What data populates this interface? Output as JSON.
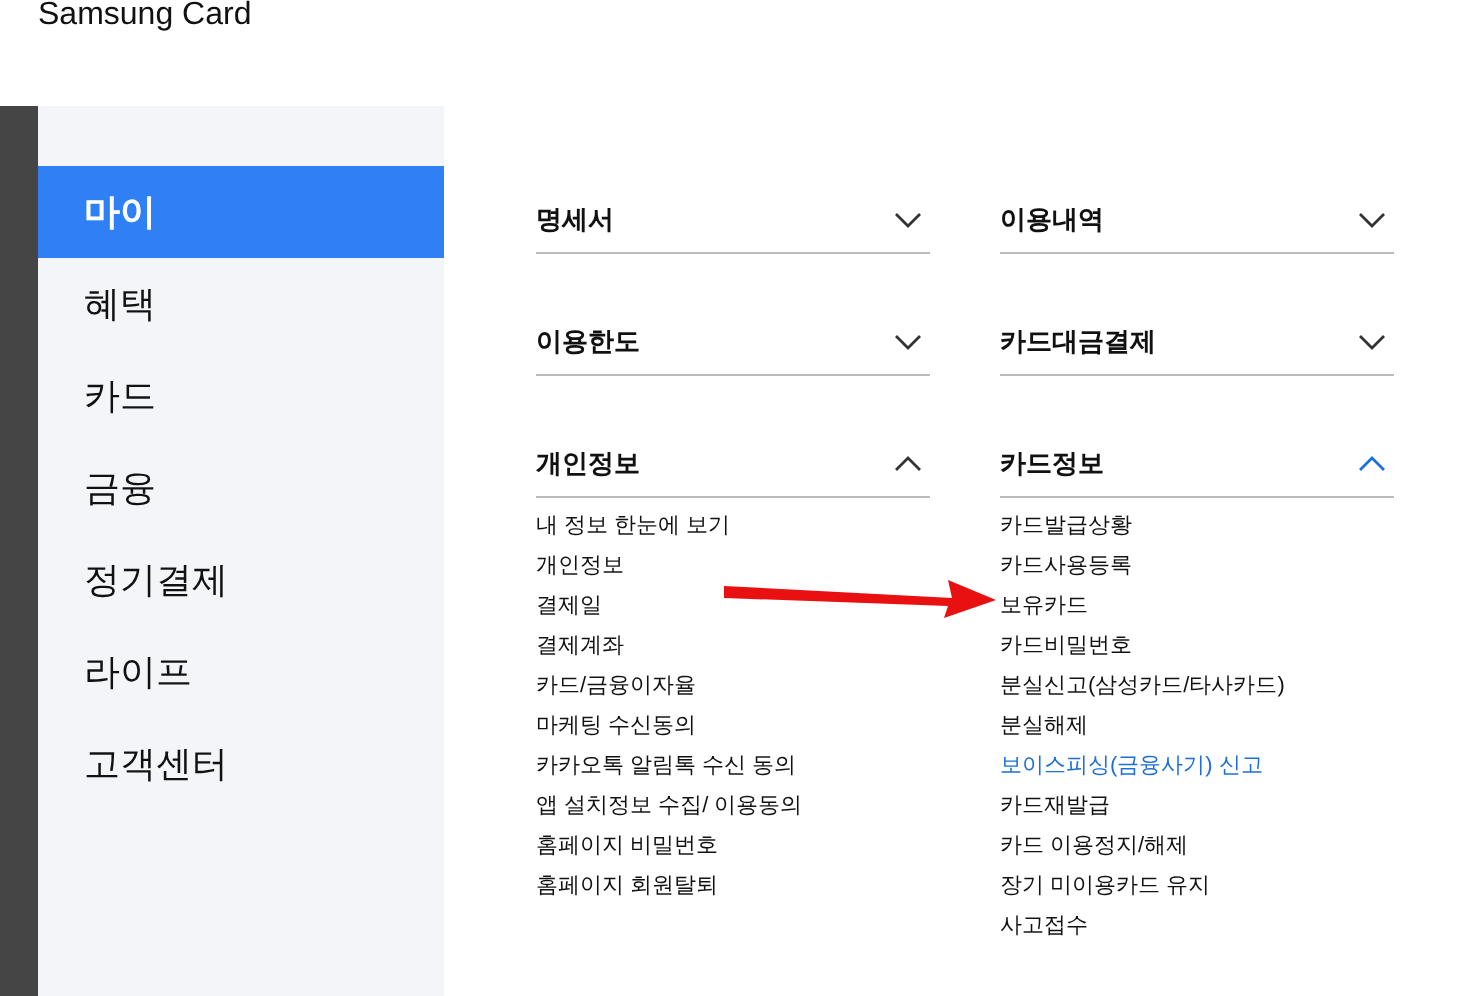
{
  "brand": "Samsung Card",
  "sidebar": {
    "items": [
      {
        "label": "마이",
        "selected": true
      },
      {
        "label": "혜택",
        "selected": false
      },
      {
        "label": "카드",
        "selected": false
      },
      {
        "label": "금융",
        "selected": false
      },
      {
        "label": "정기결제",
        "selected": false
      },
      {
        "label": "라이프",
        "selected": false
      },
      {
        "label": "고객센터",
        "selected": false
      }
    ]
  },
  "sections": [
    {
      "title": "명세서",
      "expanded": false,
      "active": false
    },
    {
      "title": "이용내역",
      "expanded": false,
      "active": false
    },
    {
      "title": "이용한도",
      "expanded": false,
      "active": false
    },
    {
      "title": "카드대금결제",
      "expanded": false,
      "active": false
    },
    {
      "title": "개인정보",
      "expanded": true,
      "active": false,
      "links": [
        {
          "label": "내 정보 한눈에 보기",
          "highlighted": false
        },
        {
          "label": "개인정보",
          "highlighted": false
        },
        {
          "label": "결제일",
          "highlighted": false
        },
        {
          "label": "결제계좌",
          "highlighted": false
        },
        {
          "label": "카드/금융이자율",
          "highlighted": false
        },
        {
          "label": "마케팅 수신동의",
          "highlighted": false
        },
        {
          "label": "카카오톡 알림톡 수신 동의",
          "highlighted": false
        },
        {
          "label": "앱 설치정보 수집/ 이용동의",
          "highlighted": false
        },
        {
          "label": "홈페이지 비밀번호",
          "highlighted": false
        },
        {
          "label": "홈페이지 회원탈퇴",
          "highlighted": false
        }
      ]
    },
    {
      "title": "카드정보",
      "expanded": true,
      "active": true,
      "links": [
        {
          "label": "카드발급상황",
          "highlighted": false
        },
        {
          "label": "카드사용등록",
          "highlighted": false
        },
        {
          "label": "보유카드",
          "highlighted": false
        },
        {
          "label": "카드비밀번호",
          "highlighted": false
        },
        {
          "label": "분실신고(삼성카드/타사카드)",
          "highlighted": false
        },
        {
          "label": "분실해제",
          "highlighted": false
        },
        {
          "label": "보이스피싱(금융사기) 신고",
          "highlighted": true
        },
        {
          "label": "카드재발급",
          "highlighted": false
        },
        {
          "label": "카드 이용정지/해제",
          "highlighted": false
        },
        {
          "label": "장기 미이용카드 유지",
          "highlighted": false
        },
        {
          "label": "사고접수",
          "highlighted": false
        }
      ]
    }
  ]
}
